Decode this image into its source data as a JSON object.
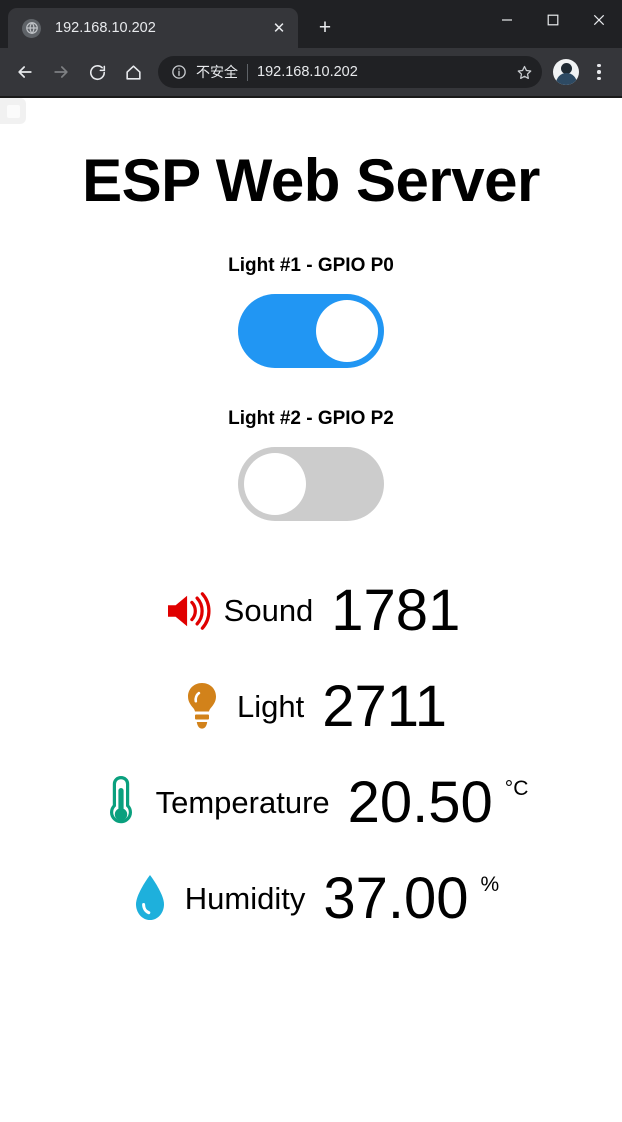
{
  "browser": {
    "tab": {
      "favicon": "globe-icon",
      "title": "192.168.10.202",
      "close_label": "✕"
    },
    "new_tab_label": "+",
    "window_controls": {
      "minimize": "minimize-icon",
      "maximize": "maximize-icon",
      "close": "close-icon"
    },
    "toolbar": {
      "back": "back-arrow-icon",
      "forward": "forward-arrow-icon",
      "reload": "reload-icon",
      "home": "home-icon",
      "bookmark": "star-icon",
      "profile": "avatar",
      "menu": "three-dot-menu-icon"
    },
    "omnibox": {
      "info_icon": "info-circle-icon",
      "security_text": "不安全",
      "url": "192.168.10.202"
    }
  },
  "page": {
    "title": "ESP Web Server",
    "switches": [
      {
        "label": "Light #1 - GPIO P0",
        "state": "on",
        "color": "#2196F3"
      },
      {
        "label": "Light #2 - GPIO P2",
        "state": "off",
        "color": "#cccccc"
      }
    ],
    "readings": [
      {
        "icon": "sound-speaker-icon",
        "label": "Sound",
        "value": "1781",
        "unit": "",
        "color": "#e00000"
      },
      {
        "icon": "lightbulb-icon",
        "label": "Light",
        "value": "2711",
        "unit": "",
        "color": "#d2821a"
      },
      {
        "icon": "thermometer-icon",
        "label": "Temperature",
        "value": "20.50",
        "unit": "°C",
        "color": "#0aa07e"
      },
      {
        "icon": "water-drop-icon",
        "label": "Humidity",
        "value": "37.00",
        "unit": "%",
        "color": "#1eb0dc"
      }
    ]
  }
}
